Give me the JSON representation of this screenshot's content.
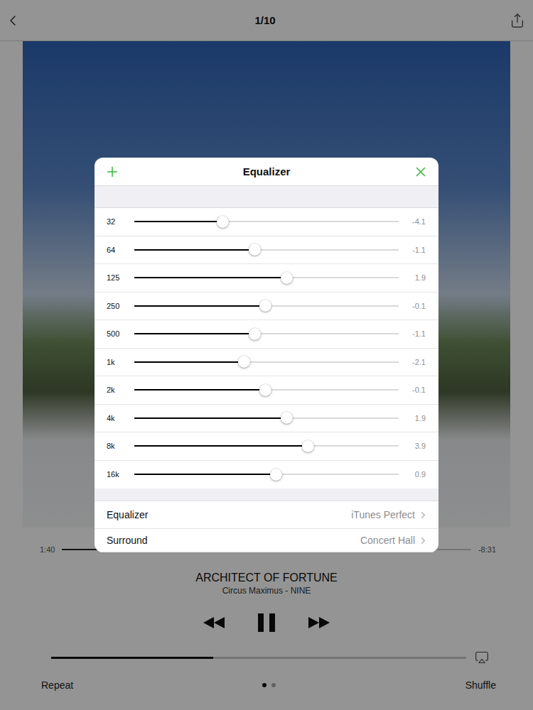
{
  "nav": {
    "title": "1/10"
  },
  "track": {
    "title": "ARCHITECT OF FORTUNE",
    "subtitle": "Circus Maximus - NINE",
    "elapsed": "1:40",
    "remaining": "-8:31",
    "level": 0.17,
    "playing": true
  },
  "volume": {
    "level": 0.39
  },
  "footer": {
    "repeat": "Repeat",
    "shuffle": "Shuffle",
    "pages": [
      {
        "selected": true
      },
      {
        "selected": false
      }
    ]
  },
  "equalizer": {
    "title": "Equalizer",
    "bands": [
      {
        "label": "32",
        "reading": "-4.1",
        "level": 0.336
      },
      {
        "label": "64",
        "reading": "-1.1",
        "level": 0.456
      },
      {
        "label": "125",
        "reading": "1.9",
        "level": 0.576
      },
      {
        "label": "250",
        "reading": "-0.1",
        "level": 0.496
      },
      {
        "label": "500",
        "reading": "-1.1",
        "level": 0.456
      },
      {
        "label": "1k",
        "reading": "-2.1",
        "level": 0.416
      },
      {
        "label": "2k",
        "reading": "-0.1",
        "level": 0.496
      },
      {
        "label": "4k",
        "reading": "1.9",
        "level": 0.576
      },
      {
        "label": "8k",
        "reading": "3.9",
        "level": 0.656
      },
      {
        "label": "16k",
        "reading": "0.9",
        "level": 0.536
      }
    ],
    "settings": [
      {
        "label": "Equalizer",
        "value": "iTunes Perfect"
      },
      {
        "label": "Surround",
        "value": "Concert Hall"
      }
    ]
  }
}
